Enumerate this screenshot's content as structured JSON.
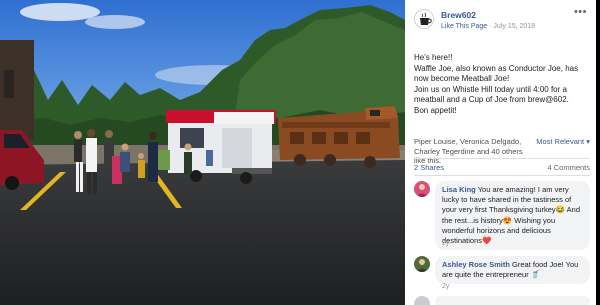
{
  "post": {
    "page_name": "Brew602",
    "like_page": "Like This Page",
    "date": "July 15, 2018",
    "more_icon": "ellipsis-icon",
    "text_lines": [
      "He's here!!",
      "Waffle Joe, also known as Conductor Joe, has now become Meatball Joe!",
      "Join us on Whistle Hill today until 4:00 for a meatball and a Cup of Joe from brew@602.",
      "Bon appetit!"
    ]
  },
  "reactions": {
    "names": "Piper Louise, Veronica Delgado, Charley Tegerdine and 40 others like this.",
    "sort": "Most Relevant ▾"
  },
  "counts": {
    "shares": "2 Shares",
    "comments": "4 Comments"
  },
  "comments": [
    {
      "author": "Lisa King",
      "text": "You are amazing! I am very lucky to have shared in the tastiness of your very first Thanksgiving turkey😂 And the rest...is history😍 Wishing you wonderful horizons and delicious destinations❤️",
      "time": "2y"
    },
    {
      "author": "Ashley Rose Smith",
      "text": "Great food Joe! You are quite the entrepreneur 🥤",
      "time": "2y"
    }
  ],
  "colors": {
    "link": "#385898",
    "bubble": "#f2f3f5",
    "trailer_red": "#c8102e"
  }
}
